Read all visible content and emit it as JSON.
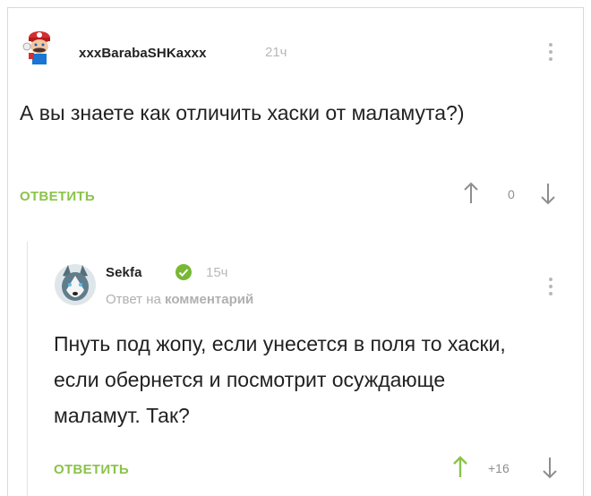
{
  "comments": [
    {
      "author": "xxxBarabaSHKaxxx",
      "time": "21ч",
      "text": "А вы знаете как отличить хаски от маламута?)",
      "reply_label": "ОТВЕТИТЬ",
      "score": "0",
      "avatar_icon": "mario-avatar-icon"
    },
    {
      "author": "Sekfa",
      "time": "15ч",
      "reply_to_prefix": "Ответ на",
      "reply_to_link": "комментарий",
      "text": "Пнуть под жопу, если унесется в поля то хаски, если обернется и посмотрит осуждающе маламут. Так?",
      "reply_label": "ОТВЕТИТЬ",
      "score": "+16",
      "avatar_icon": "husky-avatar-icon",
      "upvoted": true
    }
  ],
  "colors": {
    "accent_green": "#8bc34a",
    "muted_gray": "#b8b8b8",
    "verified_green": "#78b833"
  }
}
